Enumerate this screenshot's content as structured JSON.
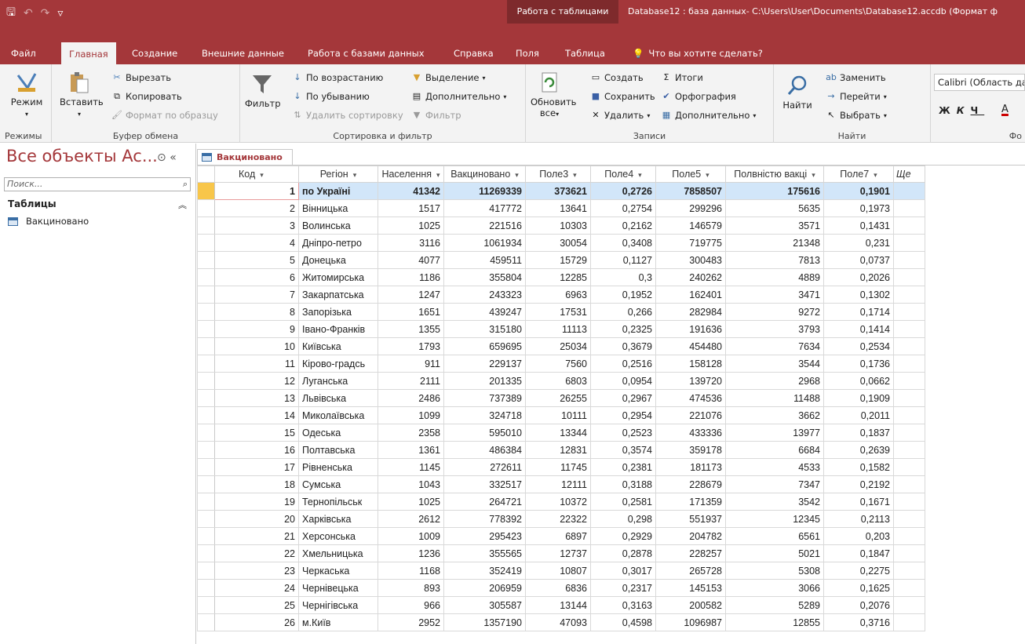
{
  "titlebar": {
    "context_group": "Работа с таблицами",
    "window_title": "Database12 : база данных- C:\\Users\\User\\Documents\\Database12.accdb (Формат ф"
  },
  "tabs": {
    "file": "Файл",
    "home": "Главная",
    "create": "Создание",
    "external": "Внешние данные",
    "dbtools": "Работа с базами данных",
    "help": "Справка",
    "fields": "Поля",
    "table": "Таблица",
    "tellme": "Что вы хотите сделать?"
  },
  "ribbon": {
    "views": {
      "mode": "Режим",
      "label": "Режимы"
    },
    "clipboard": {
      "paste": "Вставить",
      "cut": "Вырезать",
      "copy": "Копировать",
      "format_painter": "Формат по образцу",
      "label": "Буфер обмена"
    },
    "sort": {
      "filter": "Фильтр",
      "asc": "По возрастанию",
      "desc": "По убыванию",
      "remove_sort": "Удалить сортировку",
      "selection": "Выделение",
      "advanced": "Дополнительно",
      "toggle_filter": "Фильтр",
      "label": "Сортировка и фильтр"
    },
    "records": {
      "refresh": "Обновить",
      "refresh_all": "все",
      "new": "Создать",
      "save": "Сохранить",
      "delete": "Удалить",
      "totals": "Итоги",
      "spelling": "Орфография",
      "more": "Дополнительно",
      "label": "Записи"
    },
    "find": {
      "find": "Найти",
      "replace": "Заменить",
      "goto": "Перейти",
      "select": "Выбрать",
      "label": "Найти"
    },
    "text": {
      "font": "Calibri (Область данн",
      "label": "Фо"
    }
  },
  "nav": {
    "title": "Все объекты Ac...",
    "search_placeholder": "Поиск...",
    "group": "Таблицы",
    "item": "Вакциновано"
  },
  "doc_tab": "Вакциновано",
  "table": {
    "headers": [
      "Код",
      "Регіон",
      "Населення",
      "Вакциновано",
      "Поле3",
      "Поле4",
      "Поле5",
      "Полвністю вакці",
      "Поле7",
      "Ще"
    ],
    "rows": [
      [
        "1",
        "по Україні",
        "41342",
        "11269339",
        "373621",
        "0,2726",
        "7858507",
        "175616",
        "0,1901"
      ],
      [
        "2",
        "Вінницька",
        "1517",
        "417772",
        "13641",
        "0,2754",
        "299296",
        "5635",
        "0,1973"
      ],
      [
        "3",
        "Волинська",
        "1025",
        "221516",
        "10303",
        "0,2162",
        "146579",
        "3571",
        "0,1431"
      ],
      [
        "4",
        "Дніпро-петро",
        "3116",
        "1061934",
        "30054",
        "0,3408",
        "719775",
        "21348",
        "0,231"
      ],
      [
        "5",
        "Донецька",
        "4077",
        "459511",
        "15729",
        "0,1127",
        "300483",
        "7813",
        "0,0737"
      ],
      [
        "6",
        "Житомирська",
        "1186",
        "355804",
        "12285",
        "0,3",
        "240262",
        "4889",
        "0,2026"
      ],
      [
        "7",
        "Закарпатська",
        "1247",
        "243323",
        "6963",
        "0,1952",
        "162401",
        "3471",
        "0,1302"
      ],
      [
        "8",
        "Запорізька",
        "1651",
        "439247",
        "17531",
        "0,266",
        "282984",
        "9272",
        "0,1714"
      ],
      [
        "9",
        "Івано-Франків",
        "1355",
        "315180",
        "11113",
        "0,2325",
        "191636",
        "3793",
        "0,1414"
      ],
      [
        "10",
        "Київська",
        "1793",
        "659695",
        "25034",
        "0,3679",
        "454480",
        "7634",
        "0,2534"
      ],
      [
        "11",
        "Кірово-градсь",
        "911",
        "229137",
        "7560",
        "0,2516",
        "158128",
        "3544",
        "0,1736"
      ],
      [
        "12",
        "Луганська",
        "2111",
        "201335",
        "6803",
        "0,0954",
        "139720",
        "2968",
        "0,0662"
      ],
      [
        "13",
        "Львівська",
        "2486",
        "737389",
        "26255",
        "0,2967",
        "474536",
        "11488",
        "0,1909"
      ],
      [
        "14",
        "Миколаївська",
        "1099",
        "324718",
        "10111",
        "0,2954",
        "221076",
        "3662",
        "0,2011"
      ],
      [
        "15",
        "Одеська",
        "2358",
        "595010",
        "13344",
        "0,2523",
        "433336",
        "13977",
        "0,1837"
      ],
      [
        "16",
        "Полтавська",
        "1361",
        "486384",
        "12831",
        "0,3574",
        "359178",
        "6684",
        "0,2639"
      ],
      [
        "17",
        "Рівненська",
        "1145",
        "272611",
        "11745",
        "0,2381",
        "181173",
        "4533",
        "0,1582"
      ],
      [
        "18",
        "Сумська",
        "1043",
        "332517",
        "12111",
        "0,3188",
        "228679",
        "7347",
        "0,2192"
      ],
      [
        "19",
        "Тернопільськ",
        "1025",
        "264721",
        "10372",
        "0,2581",
        "171359",
        "3542",
        "0,1671"
      ],
      [
        "20",
        "Харківська",
        "2612",
        "778392",
        "22322",
        "0,298",
        "551937",
        "12345",
        "0,2113"
      ],
      [
        "21",
        "Херсонська",
        "1009",
        "295423",
        "6897",
        "0,2929",
        "204782",
        "6561",
        "0,203"
      ],
      [
        "22",
        "Хмельницька",
        "1236",
        "355565",
        "12737",
        "0,2878",
        "228257",
        "5021",
        "0,1847"
      ],
      [
        "23",
        "Черкаська",
        "1168",
        "352419",
        "10807",
        "0,3017",
        "265728",
        "5308",
        "0,2275"
      ],
      [
        "24",
        "Чернівецька",
        "893",
        "206959",
        "6836",
        "0,2317",
        "145153",
        "3066",
        "0,1625"
      ],
      [
        "25",
        "Чернігівська",
        "966",
        "305587",
        "13144",
        "0,3163",
        "200582",
        "5289",
        "0,2076"
      ],
      [
        "26",
        "м.Київ",
        "2952",
        "1357190",
        "47093",
        "0,4598",
        "1096987",
        "12855",
        "0,3716"
      ]
    ]
  },
  "colors": {
    "accent": "#a4373a",
    "selected_row": "#d2e6f9",
    "record_selector": "#f8c64a"
  }
}
